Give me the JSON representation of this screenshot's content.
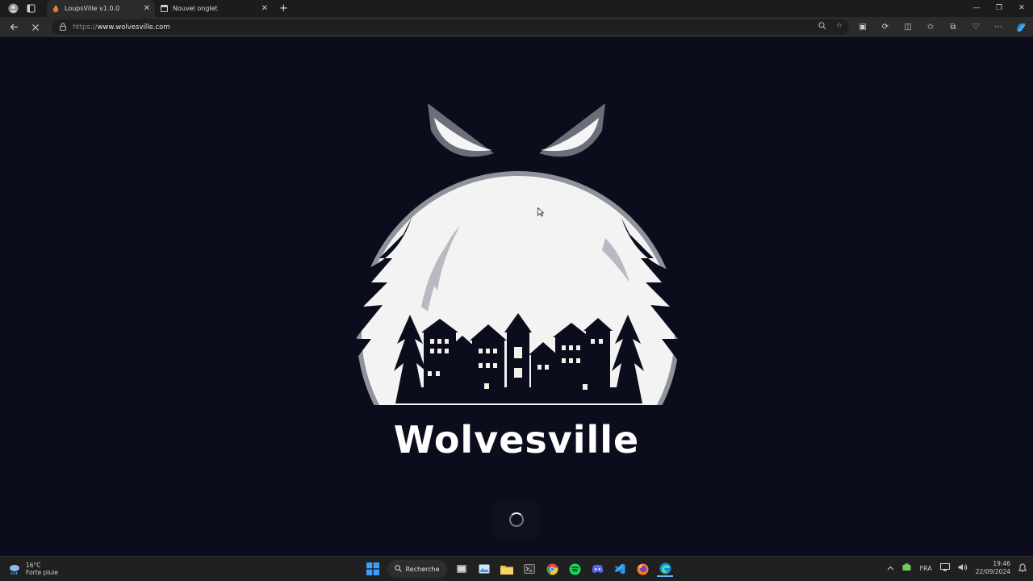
{
  "browser": {
    "tabs": [
      {
        "title": "LoupsVille v1.0.0",
        "active": true
      },
      {
        "title": "Nouvel onglet",
        "active": false
      }
    ],
    "new_tab_glyph": "+",
    "address": {
      "protocol": "https://",
      "host": "www.wolvesville.com"
    },
    "icons": [
      "profile-icon",
      "tab-actions-icon",
      "back-icon",
      "stop-loading-icon",
      "lock-icon",
      "zoom-icon",
      "favorite-star-icon",
      "extension-icon",
      "refresh-icon",
      "split-screen-icon",
      "favorites-icon",
      "collections-icon",
      "browser-essentials-icon",
      "more-icon",
      "copilot-icon"
    ]
  },
  "page": {
    "brand": "Wolvesville",
    "loading": true
  },
  "taskbar": {
    "weather": {
      "temp": "16°C",
      "condition": "Forte pluie"
    },
    "search_label": "Recherche",
    "language": "FRA",
    "time": "19:46",
    "date": "22/09/2024",
    "colors": {
      "accent": "#0078d4",
      "background": "#0b0d1c"
    }
  }
}
